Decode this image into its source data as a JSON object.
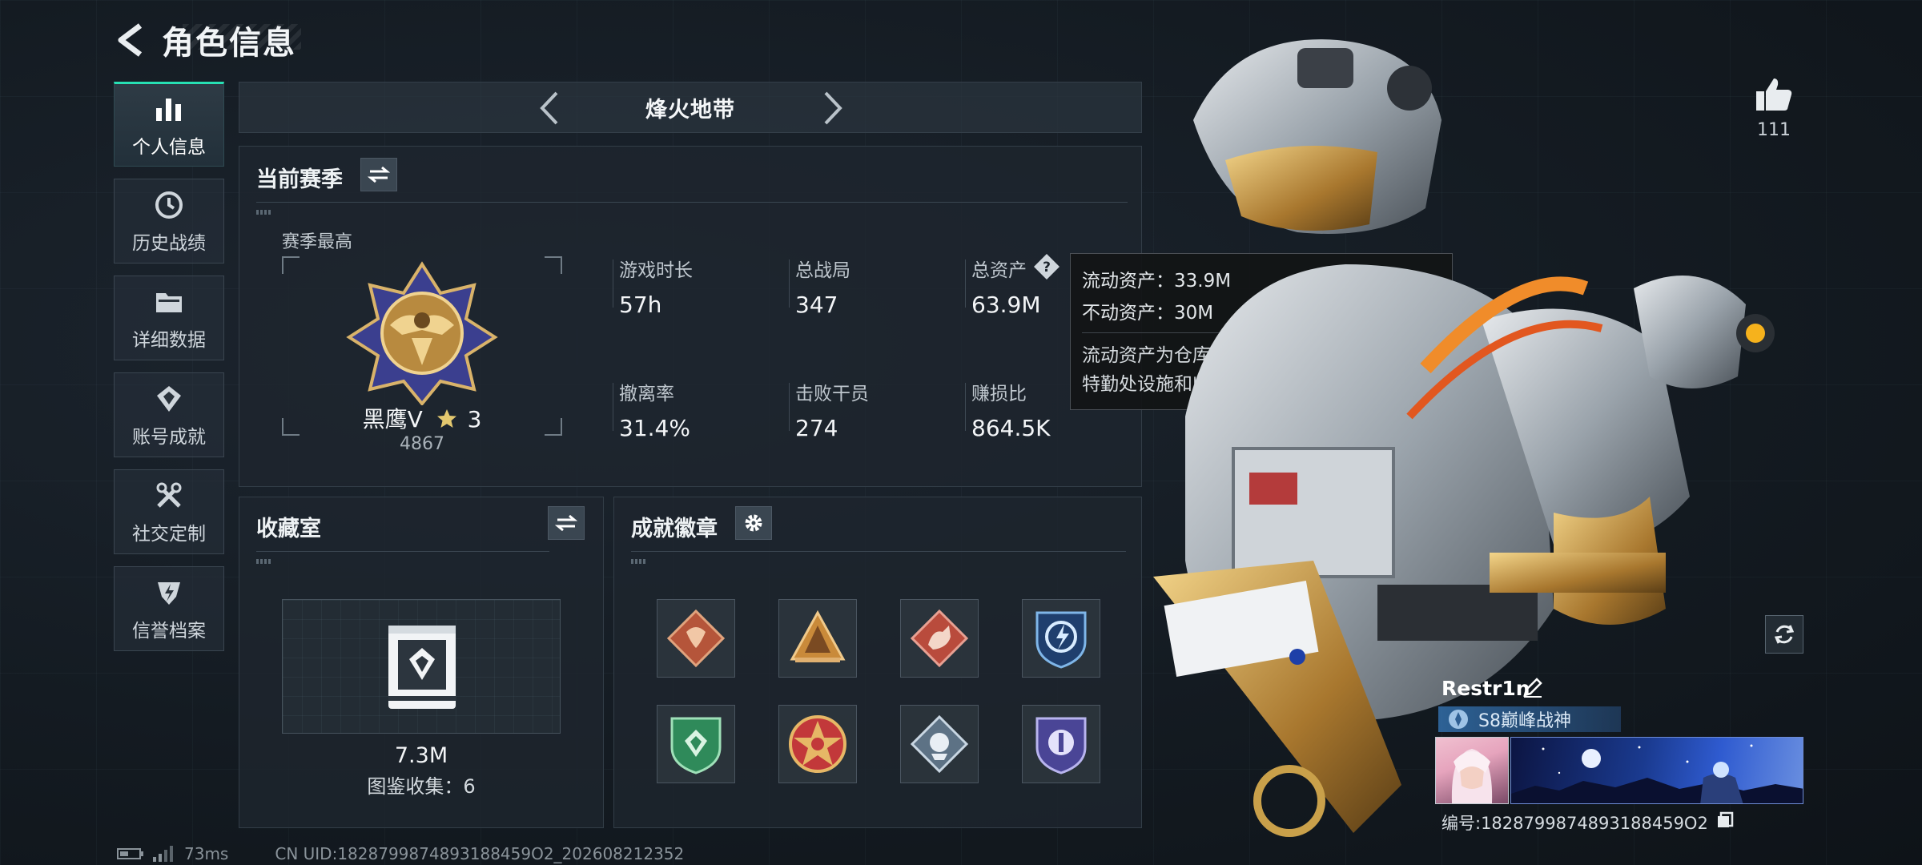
{
  "header": {
    "title": "角色信息"
  },
  "sidebar": {
    "items": [
      {
        "label": "个人信息",
        "icon": "bar-chart-icon",
        "active": true
      },
      {
        "label": "历史战绩",
        "icon": "history-icon"
      },
      {
        "label": "详细数据",
        "icon": "folder-icon"
      },
      {
        "label": "账号成就",
        "icon": "achievement-icon"
      },
      {
        "label": "社交定制",
        "icon": "wrench-icon"
      },
      {
        "label": "信誉档案",
        "icon": "shield-icon"
      }
    ]
  },
  "mode": {
    "name": "烽火地带"
  },
  "season": {
    "title": "当前赛季",
    "peak_label": "赛季最高",
    "rank_name": "黑鹰Ⅴ",
    "rank_stars": "3",
    "rank_score": "4867",
    "stats": [
      {
        "label": "游戏时长",
        "value": "57h"
      },
      {
        "label": "总战局",
        "value": "347"
      },
      {
        "label": "总资产",
        "value": "63.9M"
      },
      {
        "label": "撤离率",
        "value": "31.4%"
      },
      {
        "label": "击败干员",
        "value": "274"
      },
      {
        "label": "赚损比",
        "value": "864.5K"
      }
    ]
  },
  "tooltip": {
    "liquid": "流动资产：33.9M",
    "fixed": "不动资产：30M",
    "desc": "流动资产为仓库资产和哈夫币，不动资产为特勤处设施和收藏室设施"
  },
  "collection": {
    "title": "收藏室",
    "value": "7.3M",
    "count": "图鉴收集：6"
  },
  "badges": {
    "title": "成就徽章",
    "items": [
      {
        "icon": "dragon-badge-icon",
        "color": "#b5553a"
      },
      {
        "icon": "pyramid-badge-icon",
        "color": "#c98a3a"
      },
      {
        "icon": "rabbit-badge-icon",
        "color": "#b94b3c"
      },
      {
        "icon": "lightning-shield-badge-icon",
        "color": "#3a6ea8"
      },
      {
        "icon": "green-shield-badge-icon",
        "color": "#2f8a5a"
      },
      {
        "icon": "star-badge-icon",
        "color": "#c2383a"
      },
      {
        "icon": "diamond-badge-icon",
        "color": "#8fa3b3"
      },
      {
        "icon": "purple-shield-badge-icon",
        "color": "#6a63b5"
      }
    ]
  },
  "likes": {
    "count": "111"
  },
  "player": {
    "name": "Restr1n",
    "title": "S8巅峰战神",
    "uid": "编号:1828799874893188459O2"
  },
  "footer": {
    "ping": "73ms",
    "uid": "CN UID:1828799874893188459O2_202608212352"
  },
  "colors": {
    "accent": "#27e0b3",
    "panel": "#1e262e",
    "text": "#e6ebef"
  }
}
